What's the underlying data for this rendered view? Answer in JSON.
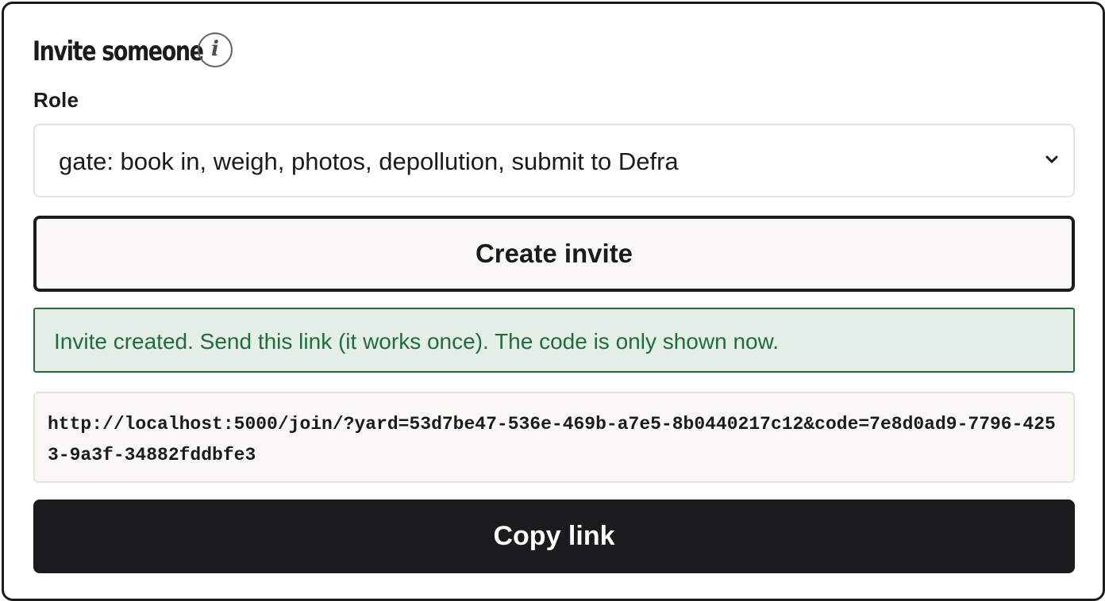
{
  "invite": {
    "title": "Invite someone",
    "info_icon": "info-icon"
  },
  "role": {
    "label": "Role",
    "selected": "gate: book in, weigh, photos, depollution, submit to Defra",
    "dropdown_icon": "chevron-down-icon"
  },
  "actions": {
    "create_label": "Create invite",
    "copy_label": "Copy link"
  },
  "alert": {
    "message": "Invite created. Send this link (it works once). The code is only shown now.",
    "color": "#226b3d",
    "background": "#e3eee6"
  },
  "invite_link": {
    "url": "http://localhost:5000/join/?yard=53d7be47-536e-469b-a7e5-8b0440217c12&code=7e8d0ad9-7796-4253-9a3f-34882fddbfe3"
  },
  "colors": {
    "primary_dark": "#1a1b1c",
    "surface": "#f9f8f4"
  }
}
